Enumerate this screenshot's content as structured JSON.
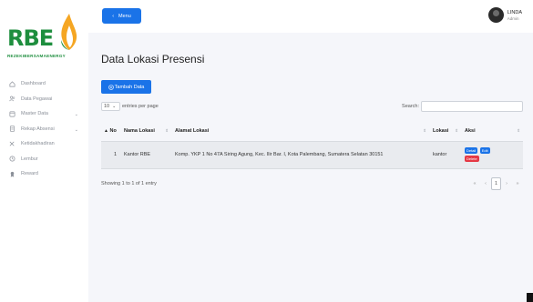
{
  "brand": {
    "name": "RBE",
    "tagline": "REZEKIBERSAMAENERGY",
    "green": "#1e8e3e",
    "flame": "#f5a623"
  },
  "sidebar": {
    "items": [
      {
        "label": "Dashboard",
        "icon": "home-icon"
      },
      {
        "label": "Data Pegawai",
        "icon": "users-icon"
      },
      {
        "label": "Master Data",
        "icon": "folder-icon",
        "has_chevron": true
      },
      {
        "label": "Rekap Absensi",
        "icon": "document-icon",
        "has_chevron": true
      },
      {
        "label": "Ketidakhadiran",
        "icon": "x-person-icon"
      },
      {
        "label": "Lembur",
        "icon": "clock-icon"
      },
      {
        "label": "Reward",
        "icon": "award-icon"
      }
    ]
  },
  "topbar": {
    "menu_label": "Menu",
    "user_name": "LINDA",
    "user_role": "Admin"
  },
  "page": {
    "title": "Data Lokasi Presensi",
    "add_button": "Tambah Data"
  },
  "table_controls": {
    "entries_value": "10",
    "entries_suffix": "entries per page",
    "search_label": "Search:",
    "search_value": ""
  },
  "table": {
    "headers": [
      "No",
      "Nama Lokasi",
      "Alamat Lokasi",
      "Lokasi",
      "Aksi"
    ],
    "rows": [
      {
        "no": "1",
        "nama": "Kantor RBE",
        "alamat": "Komp. YKP 1 No 47A Siring Agung, Kec. Ilir Bar. I, Kota Palembang, Sumatera Selatan 30151",
        "lokasi": "kantor",
        "actions": [
          "Detail",
          "Edit",
          "Delete"
        ]
      }
    ]
  },
  "footer": {
    "showing": "Showing 1 to 1 of 1 entry",
    "pages": [
      "«",
      "‹",
      "1",
      "›",
      "»"
    ]
  },
  "colors": {
    "primary": "#1a73e8",
    "danger": "#e53945",
    "background": "#f5f6fa"
  }
}
